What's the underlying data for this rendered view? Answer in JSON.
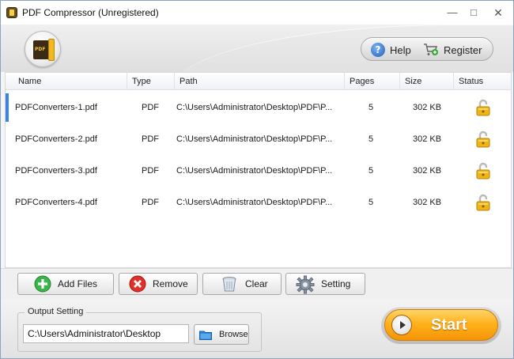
{
  "window": {
    "title": "PDF Compressor (Unregistered)"
  },
  "header": {
    "help_label": "Help",
    "register_label": "Register"
  },
  "table": {
    "columns": [
      "Name",
      "Type",
      "Path",
      "Pages",
      "Size",
      "Status"
    ],
    "rows": [
      {
        "name": "PDFConverters-1.pdf",
        "type": "PDF",
        "path": "C:\\Users\\Administrator\\Desktop\\PDF\\P...",
        "pages": "5",
        "size": "302 KB",
        "status": "unlocked"
      },
      {
        "name": "PDFConverters-2.pdf",
        "type": "PDF",
        "path": "C:\\Users\\Administrator\\Desktop\\PDF\\P...",
        "pages": "5",
        "size": "302 KB",
        "status": "unlocked"
      },
      {
        "name": "PDFConverters-3.pdf",
        "type": "PDF",
        "path": "C:\\Users\\Administrator\\Desktop\\PDF\\P...",
        "pages": "5",
        "size": "302 KB",
        "status": "unlocked"
      },
      {
        "name": "PDFConverters-4.pdf",
        "type": "PDF",
        "path": "C:\\Users\\Administrator\\Desktop\\PDF\\P...",
        "pages": "5",
        "size": "302 KB",
        "status": "unlocked"
      }
    ]
  },
  "actions": {
    "add_files": "Add Files",
    "remove": "Remove",
    "clear": "Clear",
    "setting": "Setting"
  },
  "output": {
    "group_title": "Output Setting",
    "path_value": "C:\\Users\\Administrator\\Desktop",
    "browse_label": "Browse"
  },
  "start_label": "Start",
  "colors": {
    "accent": "#3b82e8",
    "start_orange": "#ffb21c",
    "lock_gold": "#e8a90c"
  }
}
